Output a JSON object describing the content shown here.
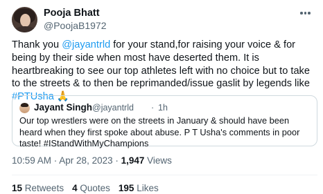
{
  "author": {
    "name": "Pooja Bhatt",
    "handle": "@PoojaB1972"
  },
  "body": {
    "text1": "Thank you ",
    "mention": "@jayantrld",
    "text2": " for your stand,for raising your voice & for being by their side when most have deserted them. It is heartbreaking to see our top athletes left with no choice but to take to the streets & to then be reprimanded/issue gaslit by legends like ",
    "hashtag": "#PTUsha",
    "emoji": " 🙏"
  },
  "quote": {
    "name": "Jayant Singh",
    "handle": "@jayantrld",
    "separator": "·",
    "time": "1h",
    "text": "Our top wrestlers were on the streets in January & should have been heard when they first spoke about abuse. P T Usha's comments in poor taste! #IStandWithMyChampions"
  },
  "meta": {
    "time": "10:59 AM · Apr 28, 2023 · ",
    "views_count": "1,947",
    "views_label": " Views"
  },
  "stats": {
    "retweets_count": "15",
    "retweets_label": "Retweets",
    "quotes_count": "4",
    "quotes_label": "Quotes",
    "likes_count": "195",
    "likes_label": "Likes"
  },
  "icons": {
    "more": "more-horizontal-icon"
  }
}
